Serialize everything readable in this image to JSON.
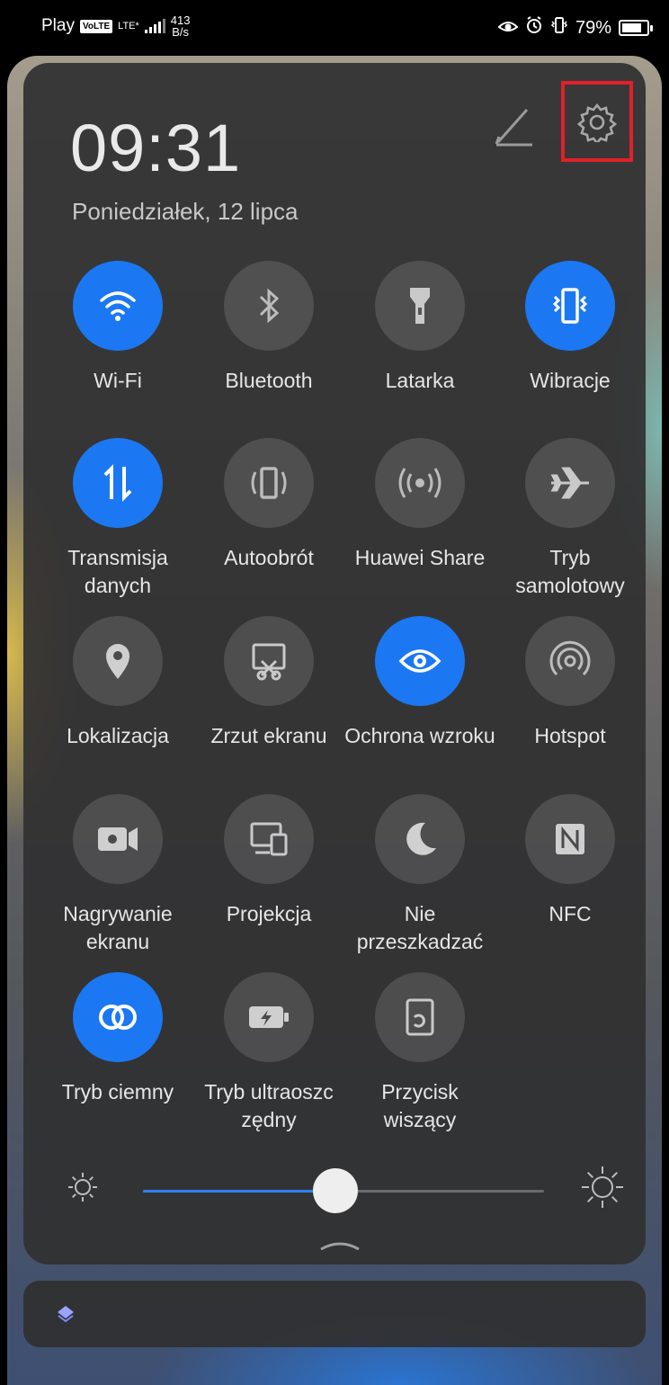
{
  "status_bar": {
    "carrier": "Play",
    "volte": "VoLTE",
    "network": "LTE*",
    "speed_value": "413",
    "speed_unit": "B/s",
    "battery_text": "79%",
    "battery_level": 0.79
  },
  "header": {
    "time": "09:31",
    "date": "Poniedziałek, 12 lipca"
  },
  "tiles": [
    {
      "id": "wifi",
      "label": "Wi-Fi",
      "icon": "wifi-icon",
      "on": true
    },
    {
      "id": "bluetooth",
      "label": "Bluetooth",
      "icon": "bluetooth-icon",
      "on": false
    },
    {
      "id": "flashlight",
      "label": "Latarka",
      "icon": "flashlight-icon",
      "on": false
    },
    {
      "id": "vibration",
      "label": "Wibracje",
      "icon": "vibration-icon",
      "on": true
    },
    {
      "id": "mobile-data",
      "label": "Transmisja danych",
      "icon": "data-transfer-icon",
      "on": true
    },
    {
      "id": "auto-rotate",
      "label": "Autoobrót",
      "icon": "auto-rotate-icon",
      "on": false
    },
    {
      "id": "huawei-share",
      "label": "Huawei Share",
      "icon": "huawei-share-icon",
      "on": false
    },
    {
      "id": "airplane",
      "label": "Tryb samolotowy",
      "icon": "airplane-icon",
      "on": false
    },
    {
      "id": "location",
      "label": "Lokalizacja",
      "icon": "location-icon",
      "on": false
    },
    {
      "id": "screenshot",
      "label": "Zrzut ekranu",
      "icon": "screenshot-icon",
      "on": false
    },
    {
      "id": "eye-comfort",
      "label": "Ochrona wzroku",
      "icon": "eye-icon",
      "on": true
    },
    {
      "id": "hotspot",
      "label": "Hotspot",
      "icon": "hotspot-icon",
      "on": false
    },
    {
      "id": "screen-record",
      "label": "Nagrywanie ekranu",
      "icon": "screen-record-icon",
      "on": false
    },
    {
      "id": "projection",
      "label": "Projekcja",
      "icon": "projection-icon",
      "on": false
    },
    {
      "id": "dnd",
      "label": "Nie przeszkadzać",
      "icon": "moon-icon",
      "on": false
    },
    {
      "id": "nfc",
      "label": "NFC",
      "icon": "nfc-icon",
      "on": false
    },
    {
      "id": "dark-mode",
      "label": "Tryb ciemny",
      "icon": "dark-mode-icon",
      "on": true
    },
    {
      "id": "ultra-saver",
      "label": "Tryb ultraoszc zędny",
      "icon": "battery-saver-icon",
      "on": false
    },
    {
      "id": "floating-button",
      "label": "Przycisk wiszący",
      "icon": "floating-button-icon",
      "on": false
    }
  ],
  "brightness": {
    "level": 0.48
  },
  "colors": {
    "accent": "#1b78f2",
    "tile_off": "#4a4a4c",
    "highlight_box": "#e0202a"
  }
}
